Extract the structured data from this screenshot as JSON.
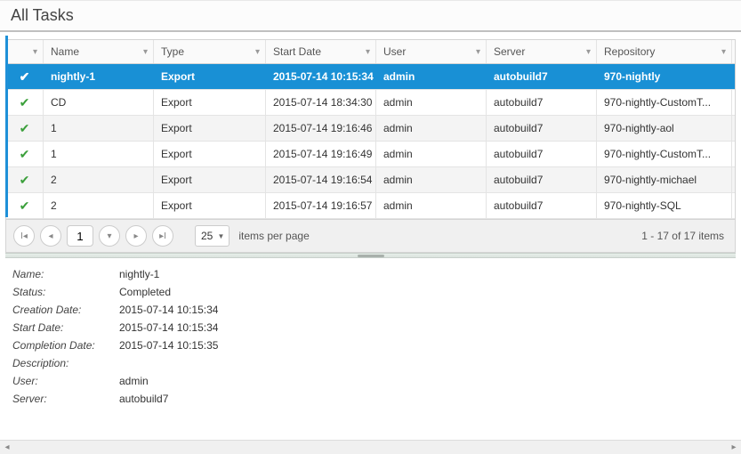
{
  "title": "All Tasks",
  "columns": [
    "Name",
    "Type",
    "Start Date",
    "User",
    "Server",
    "Repository"
  ],
  "rows": [
    {
      "status": "ok",
      "name": "nightly-1",
      "type": "Export",
      "date": "2015-07-14 10:15:34",
      "user": "admin",
      "server": "autobuild7",
      "repo": "970-nightly",
      "selected": true
    },
    {
      "status": "ok",
      "name": "CD",
      "type": "Export",
      "date": "2015-07-14 18:34:30",
      "user": "admin",
      "server": "autobuild7",
      "repo": "970-nightly-CustomT..."
    },
    {
      "status": "ok",
      "name": "1",
      "type": "Export",
      "date": "2015-07-14 19:16:46",
      "user": "admin",
      "server": "autobuild7",
      "repo": "970-nightly-aol"
    },
    {
      "status": "ok",
      "name": "1",
      "type": "Export",
      "date": "2015-07-14 19:16:49",
      "user": "admin",
      "server": "autobuild7",
      "repo": "970-nightly-CustomT..."
    },
    {
      "status": "ok",
      "name": "2",
      "type": "Export",
      "date": "2015-07-14 19:16:54",
      "user": "admin",
      "server": "autobuild7",
      "repo": "970-nightly-michael"
    },
    {
      "status": "ok",
      "name": "2",
      "type": "Export",
      "date": "2015-07-14 19:16:57",
      "user": "admin",
      "server": "autobuild7",
      "repo": "970-nightly-SQL"
    }
  ],
  "pager": {
    "page": "1",
    "pageSize": "25",
    "perPageLabel": "items per page",
    "summary": "1 - 17 of 17 items"
  },
  "details": {
    "labels": {
      "name": "Name:",
      "status": "Status:",
      "creation": "Creation Date:",
      "start": "Start Date:",
      "completion": "Completion Date:",
      "description": "Description:",
      "user": "User:",
      "server": "Server:"
    },
    "values": {
      "name": "nightly-1",
      "status": "Completed",
      "creation": "2015-07-14 10:15:34",
      "start": "2015-07-14 10:15:34",
      "completion": "2015-07-14 10:15:35",
      "description": "",
      "user": "admin",
      "server": "autobuild7"
    }
  }
}
